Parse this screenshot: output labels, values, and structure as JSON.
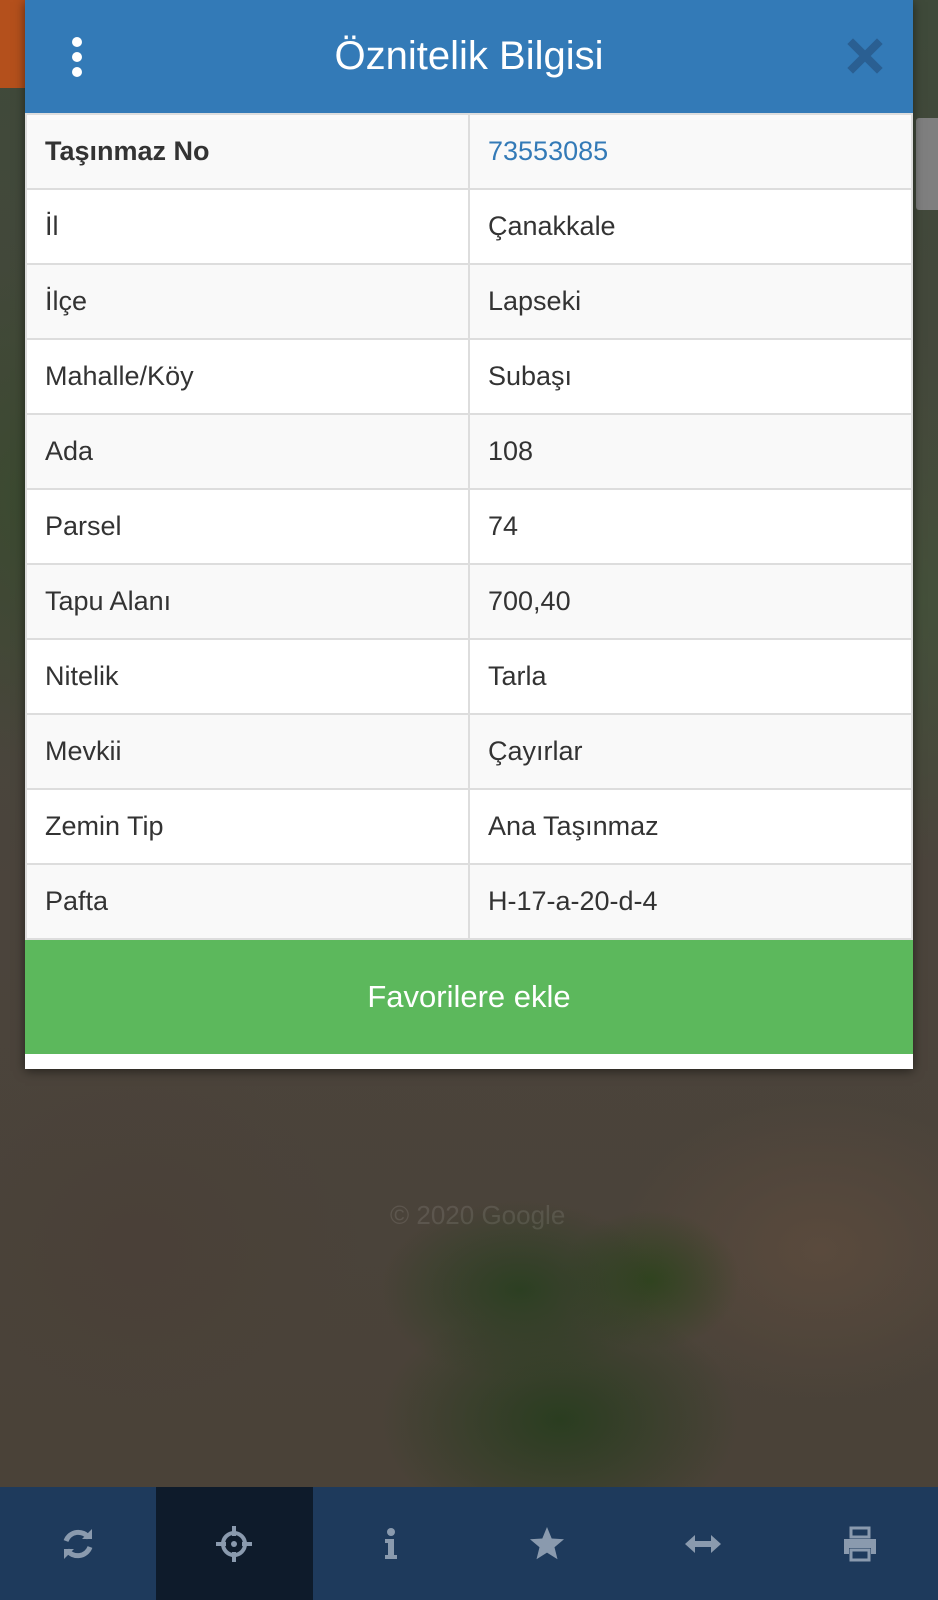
{
  "dialog": {
    "title": "Öznitelik Bilgisi",
    "rows": [
      {
        "label": "Taşınmaz No",
        "value": "73553085"
      },
      {
        "label": "İl",
        "value": "Çanakkale"
      },
      {
        "label": "İlçe",
        "value": "Lapseki"
      },
      {
        "label": "Mahalle/Köy",
        "value": "Subaşı"
      },
      {
        "label": "Ada",
        "value": "108"
      },
      {
        "label": "Parsel",
        "value": "74"
      },
      {
        "label": "Tapu Alanı",
        "value": "700,40"
      },
      {
        "label": "Nitelik",
        "value": "Tarla"
      },
      {
        "label": "Mevkii",
        "value": "Çayırlar"
      },
      {
        "label": "Zemin Tip",
        "value": "Ana Taşınmaz"
      },
      {
        "label": "Pafta",
        "value": "H-17-a-20-d-4"
      }
    ],
    "favorite_label": "Favorilere ekle"
  },
  "map": {
    "watermark": "© 2020 Google"
  },
  "toolbar": {
    "items": [
      {
        "icon": "refresh-icon"
      },
      {
        "icon": "crosshairs-icon",
        "active": true
      },
      {
        "icon": "info-icon"
      },
      {
        "icon": "star-icon"
      },
      {
        "icon": "arrows-horizontal-icon"
      },
      {
        "icon": "print-icon"
      }
    ]
  },
  "colors": {
    "header": "#337ab7",
    "favorite_button": "#5cb85c",
    "toolbar": "#1e3a5c",
    "toolbar_active": "#0e1b2b",
    "toolbar_icon": "#8a9aae",
    "link": "#337ab7"
  }
}
